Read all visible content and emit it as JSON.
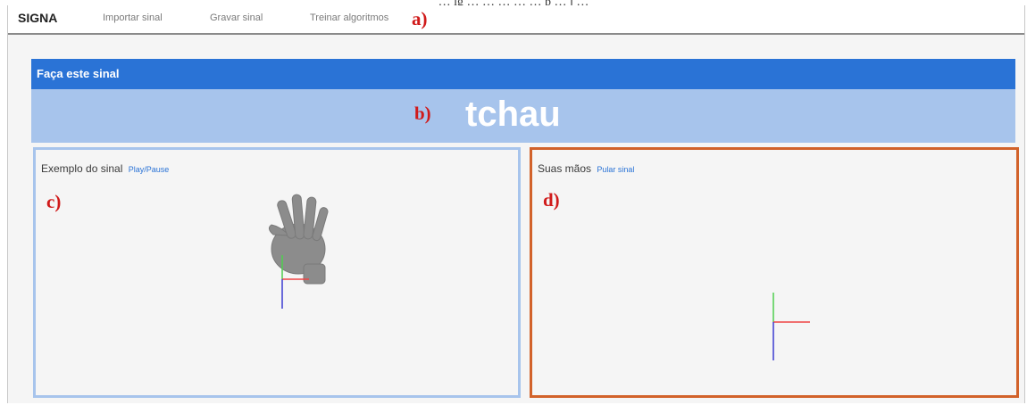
{
  "figure_caption": "… ig … … … … … p … j …",
  "navbar": {
    "brand": "SIGNA",
    "links": [
      "Importar sinal",
      "Gravar sinal",
      "Treinar algoritmos"
    ]
  },
  "annotations": {
    "a": "a)",
    "b": "b)",
    "c": "c)",
    "d": "d)"
  },
  "instruction": {
    "label": "Faça este sinal"
  },
  "sign": {
    "word": "tchau"
  },
  "example_panel": {
    "title": "Exemplo do sinal",
    "action": "Play/Pause"
  },
  "user_panel": {
    "title": "Suas mãos",
    "action": "Pular sinal"
  },
  "colors": {
    "accent": "#2a73d6",
    "banner": "#a7c4ec",
    "user_panel_border": "#d2622a",
    "annotation": "#d01a1a"
  }
}
